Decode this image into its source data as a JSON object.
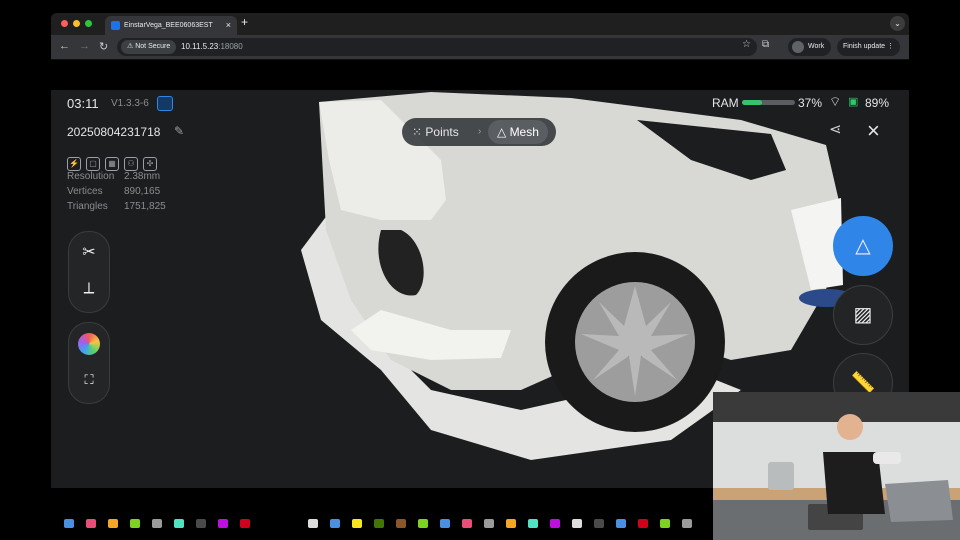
{
  "browser": {
    "tab_title": "EinstarVega_BEE06063EST",
    "tab_close": "×",
    "new_tab": "+",
    "window_menu": "⌄",
    "nav_back": "←",
    "nav_forward": "→",
    "nav_reload": "↻",
    "security_label": "Not Secure",
    "url_host": "10.11.5.23",
    "url_port": ":18080",
    "bookmark_icon": "☆",
    "extensions_icon": "⧉",
    "profile_label": "Work",
    "update_label": "Finish update",
    "update_menu": "⋮"
  },
  "app": {
    "time": "03:11",
    "version": "V1.3.3-6",
    "project_name": "20250804231718",
    "stats": [
      {
        "label": "Resolution",
        "value": "2.38mm"
      },
      {
        "label": "Vertices",
        "value": "890,165"
      },
      {
        "label": "Triangles",
        "value": "1751,825"
      }
    ],
    "mode_tabs": [
      {
        "label": "Points",
        "icon": "points-icon"
      },
      {
        "label": "Mesh",
        "icon": "mesh-icon",
        "active": true
      }
    ],
    "status": {
      "ram_label": "RAM",
      "ram_percent": "37%",
      "ram_fraction": 0.37,
      "battery_percent": "89%"
    },
    "close_icon": "×",
    "colors": {
      "accent": "#2f86e8",
      "ram_bar": "#35c46a",
      "background": "#1b1d1f"
    }
  }
}
